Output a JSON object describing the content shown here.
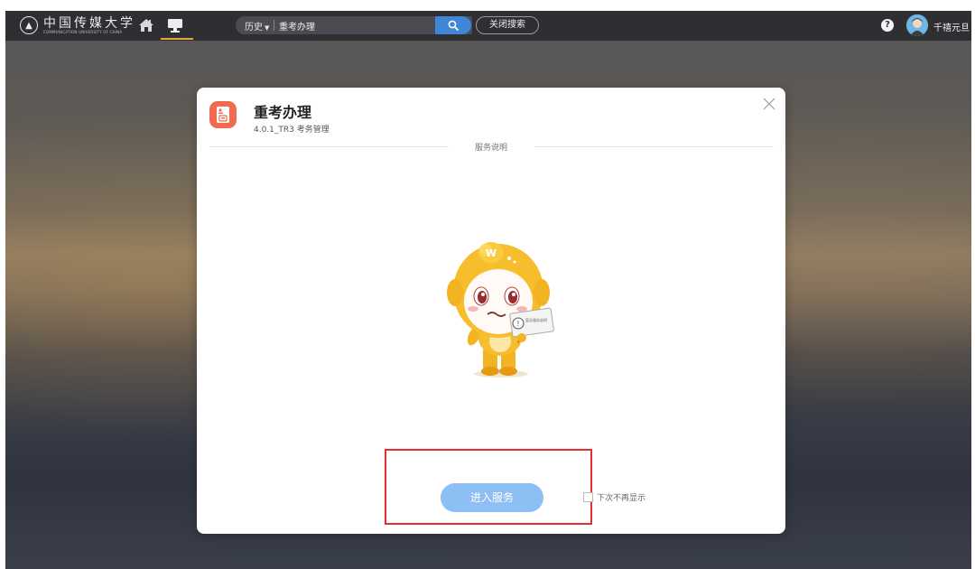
{
  "header": {
    "logo_cn": "中国传媒大学",
    "logo_en": "COMMUNICATION UNIVERSITY OF CHINA",
    "search": {
      "history_label": "历史",
      "query": "重考办理"
    },
    "close_search_label": "关闭搜索",
    "help_label": "?",
    "username": "千禧元旦"
  },
  "modal": {
    "title": "重考办理",
    "subtitle": "4.0.1_TR3 考务管理",
    "section_label": "服务说明",
    "mascot_sign_text": "暂无服务说明",
    "enter_button": "进入服务",
    "dont_show_label": "下次不再显示",
    "dont_show_checked": false
  },
  "colors": {
    "topbar_bg": "#2d2f33",
    "search_button": "#3f86d8",
    "nav_active_underline": "#e0a640",
    "app_icon": "#f06b4f",
    "enter_button": "#8dbef4",
    "highlight_box": "#e62e2e"
  },
  "icons": [
    "logo-seal-icon",
    "home-icon",
    "desktop-icon",
    "caret-down-icon",
    "search-icon",
    "help-icon",
    "avatar-icon",
    "app-document-icon",
    "close-icon",
    "mascot-illustration"
  ]
}
